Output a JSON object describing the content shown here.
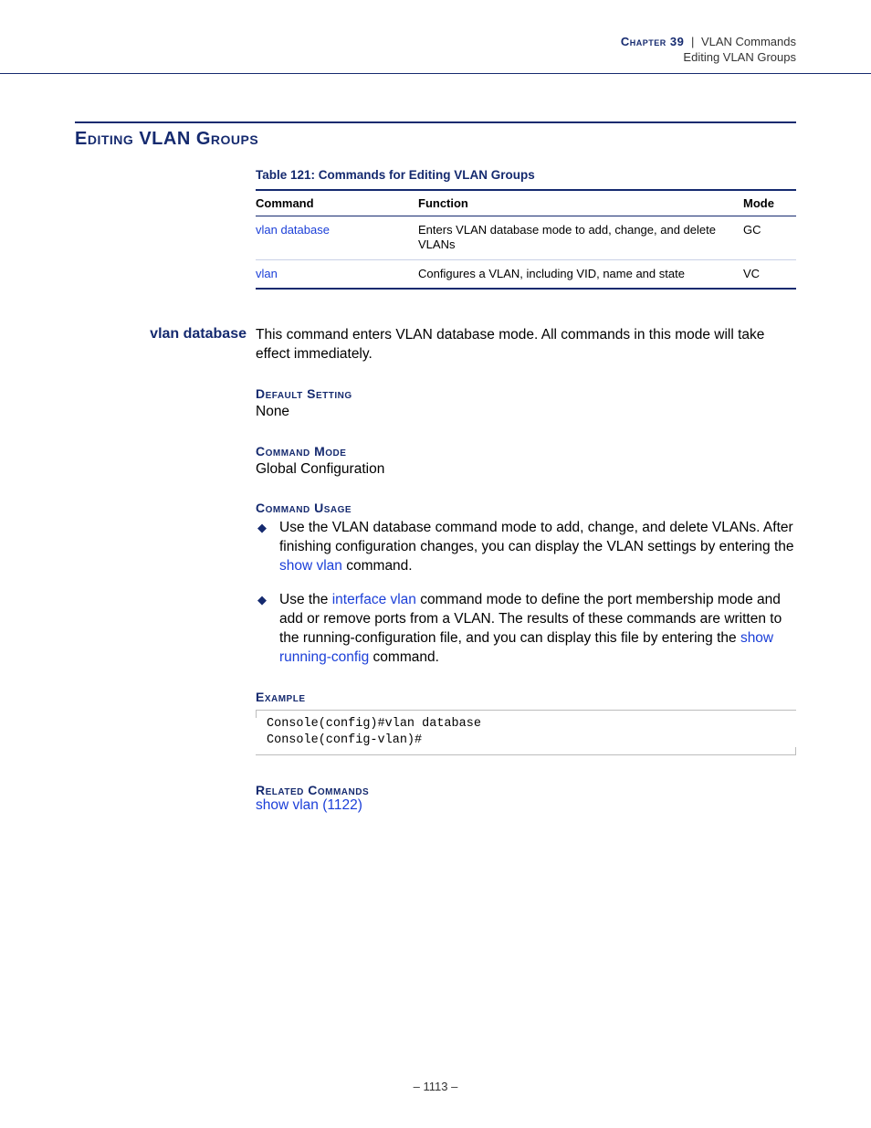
{
  "header": {
    "chapter_label": "Chapter 39",
    "separator": "|",
    "chapter_title": "VLAN Commands",
    "sub_title": "Editing VLAN Groups"
  },
  "section": {
    "title": "Editing VLAN Groups"
  },
  "table": {
    "caption": "Table 121: Commands for Editing VLAN Groups",
    "headers": {
      "command": "Command",
      "function": "Function",
      "mode": "Mode"
    },
    "rows": [
      {
        "command": "vlan database",
        "function": "Enters VLAN database mode to add, change, and delete VLANs",
        "mode": "GC"
      },
      {
        "command": "vlan",
        "function": "Configures a VLAN, including VID, name and state",
        "mode": "VC"
      }
    ]
  },
  "entry": {
    "name": "vlan database",
    "description": "This command enters VLAN database mode. All commands in this mode will take effect immediately.",
    "default_setting": {
      "heading": "Default Setting",
      "value": "None"
    },
    "command_mode": {
      "heading": "Command Mode",
      "value": "Global Configuration"
    },
    "command_usage_heading": "Command Usage",
    "usage": {
      "b1": {
        "pre": "Use the VLAN database command mode to add, change, and delete VLANs. After finishing configuration changes, you can display the VLAN settings by entering the ",
        "link": "show vlan",
        "post": " command."
      },
      "b2": {
        "pre": "Use the ",
        "link1": "interface vlan",
        "mid": " command mode to define the port membership mode and add or remove ports from a VLAN. The results of these commands are written to the running-configuration file, and you can display this file by entering the ",
        "link2": "show running-config",
        "post": " command."
      }
    },
    "example_heading": "Example",
    "example_code": "Console(config)#vlan database\nConsole(config-vlan)#",
    "related_heading": "Related Commands",
    "related_link": "show vlan (1122)"
  },
  "page_number": "– 1113 –"
}
